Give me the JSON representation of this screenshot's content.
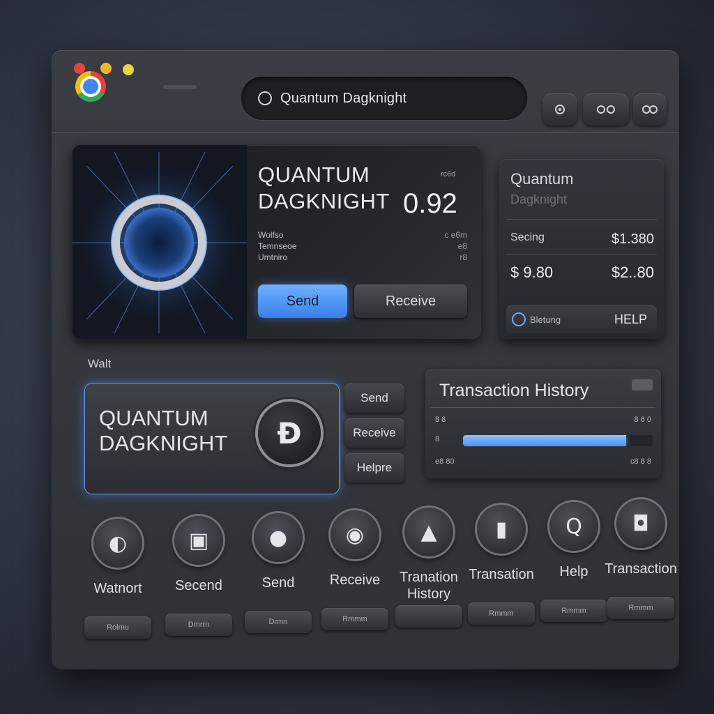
{
  "browser": {
    "address_text": "Quantum Dagknight"
  },
  "hero": {
    "name_line1": "QUANTUM",
    "name_line2": "DAGKNIGHT",
    "value": "0.92",
    "small_label": "rc6d",
    "rows": [
      {
        "label": "Wolfso",
        "value": "c e6m"
      },
      {
        "label": "Temnseoe",
        "value": "e8"
      },
      {
        "label": "Umtniro",
        "value": "r8"
      }
    ],
    "send_label": "Send",
    "receive_label": "Receive"
  },
  "side_panel": {
    "title": "Quantum",
    "subtitle": "Dagknight",
    "row1_label": "Secing",
    "row1_value": "$1.380",
    "row2_left": "$ 9.80",
    "row2_right": "$2..80",
    "footer_text": "Bletung",
    "help_label": "HELP"
  },
  "wallet": {
    "section_label": "Walt",
    "name_line1": "QUANTUM",
    "name_line2": "DAGKNIGHT",
    "coin_symbol": "Ɖ",
    "buttons": [
      "Send",
      "Receive",
      "Helpre"
    ]
  },
  "transactions": {
    "title": "Transaction History",
    "row1_left": "8 8",
    "row1_right": "8 6 0",
    "row2_left": "8",
    "row3_left": "e8 80",
    "row3_right": "c8 8 8",
    "progress": 0.86
  },
  "bottom_nav": [
    {
      "label": "Watnort",
      "pill": "Rolmu",
      "icon": "wallet-icon",
      "glyph": "◐"
    },
    {
      "label": "Secend",
      "pill": "Dmrrn",
      "icon": "lock-icon",
      "glyph": "▣"
    },
    {
      "label": "Send",
      "pill": "Drmn",
      "icon": "circle-icon",
      "glyph": "●"
    },
    {
      "label": "Receive",
      "pill": "Rmmm",
      "icon": "coin-icon",
      "glyph": "◉"
    },
    {
      "label": "Tranation History",
      "pill": "",
      "icon": "user-icon",
      "glyph": "▲"
    },
    {
      "label": "Transation",
      "pill": "Rmmm",
      "icon": "card-icon",
      "glyph": "▮"
    },
    {
      "label": "Help",
      "pill": "Rmmm",
      "icon": "help-icon",
      "glyph": "Q"
    },
    {
      "label": "Transaction",
      "pill": "Rmmm",
      "icon": "transaction-icon",
      "glyph": "◘"
    }
  ],
  "colors": {
    "accent_blue": "#4a8ff0",
    "window_bg": "#34373c"
  }
}
